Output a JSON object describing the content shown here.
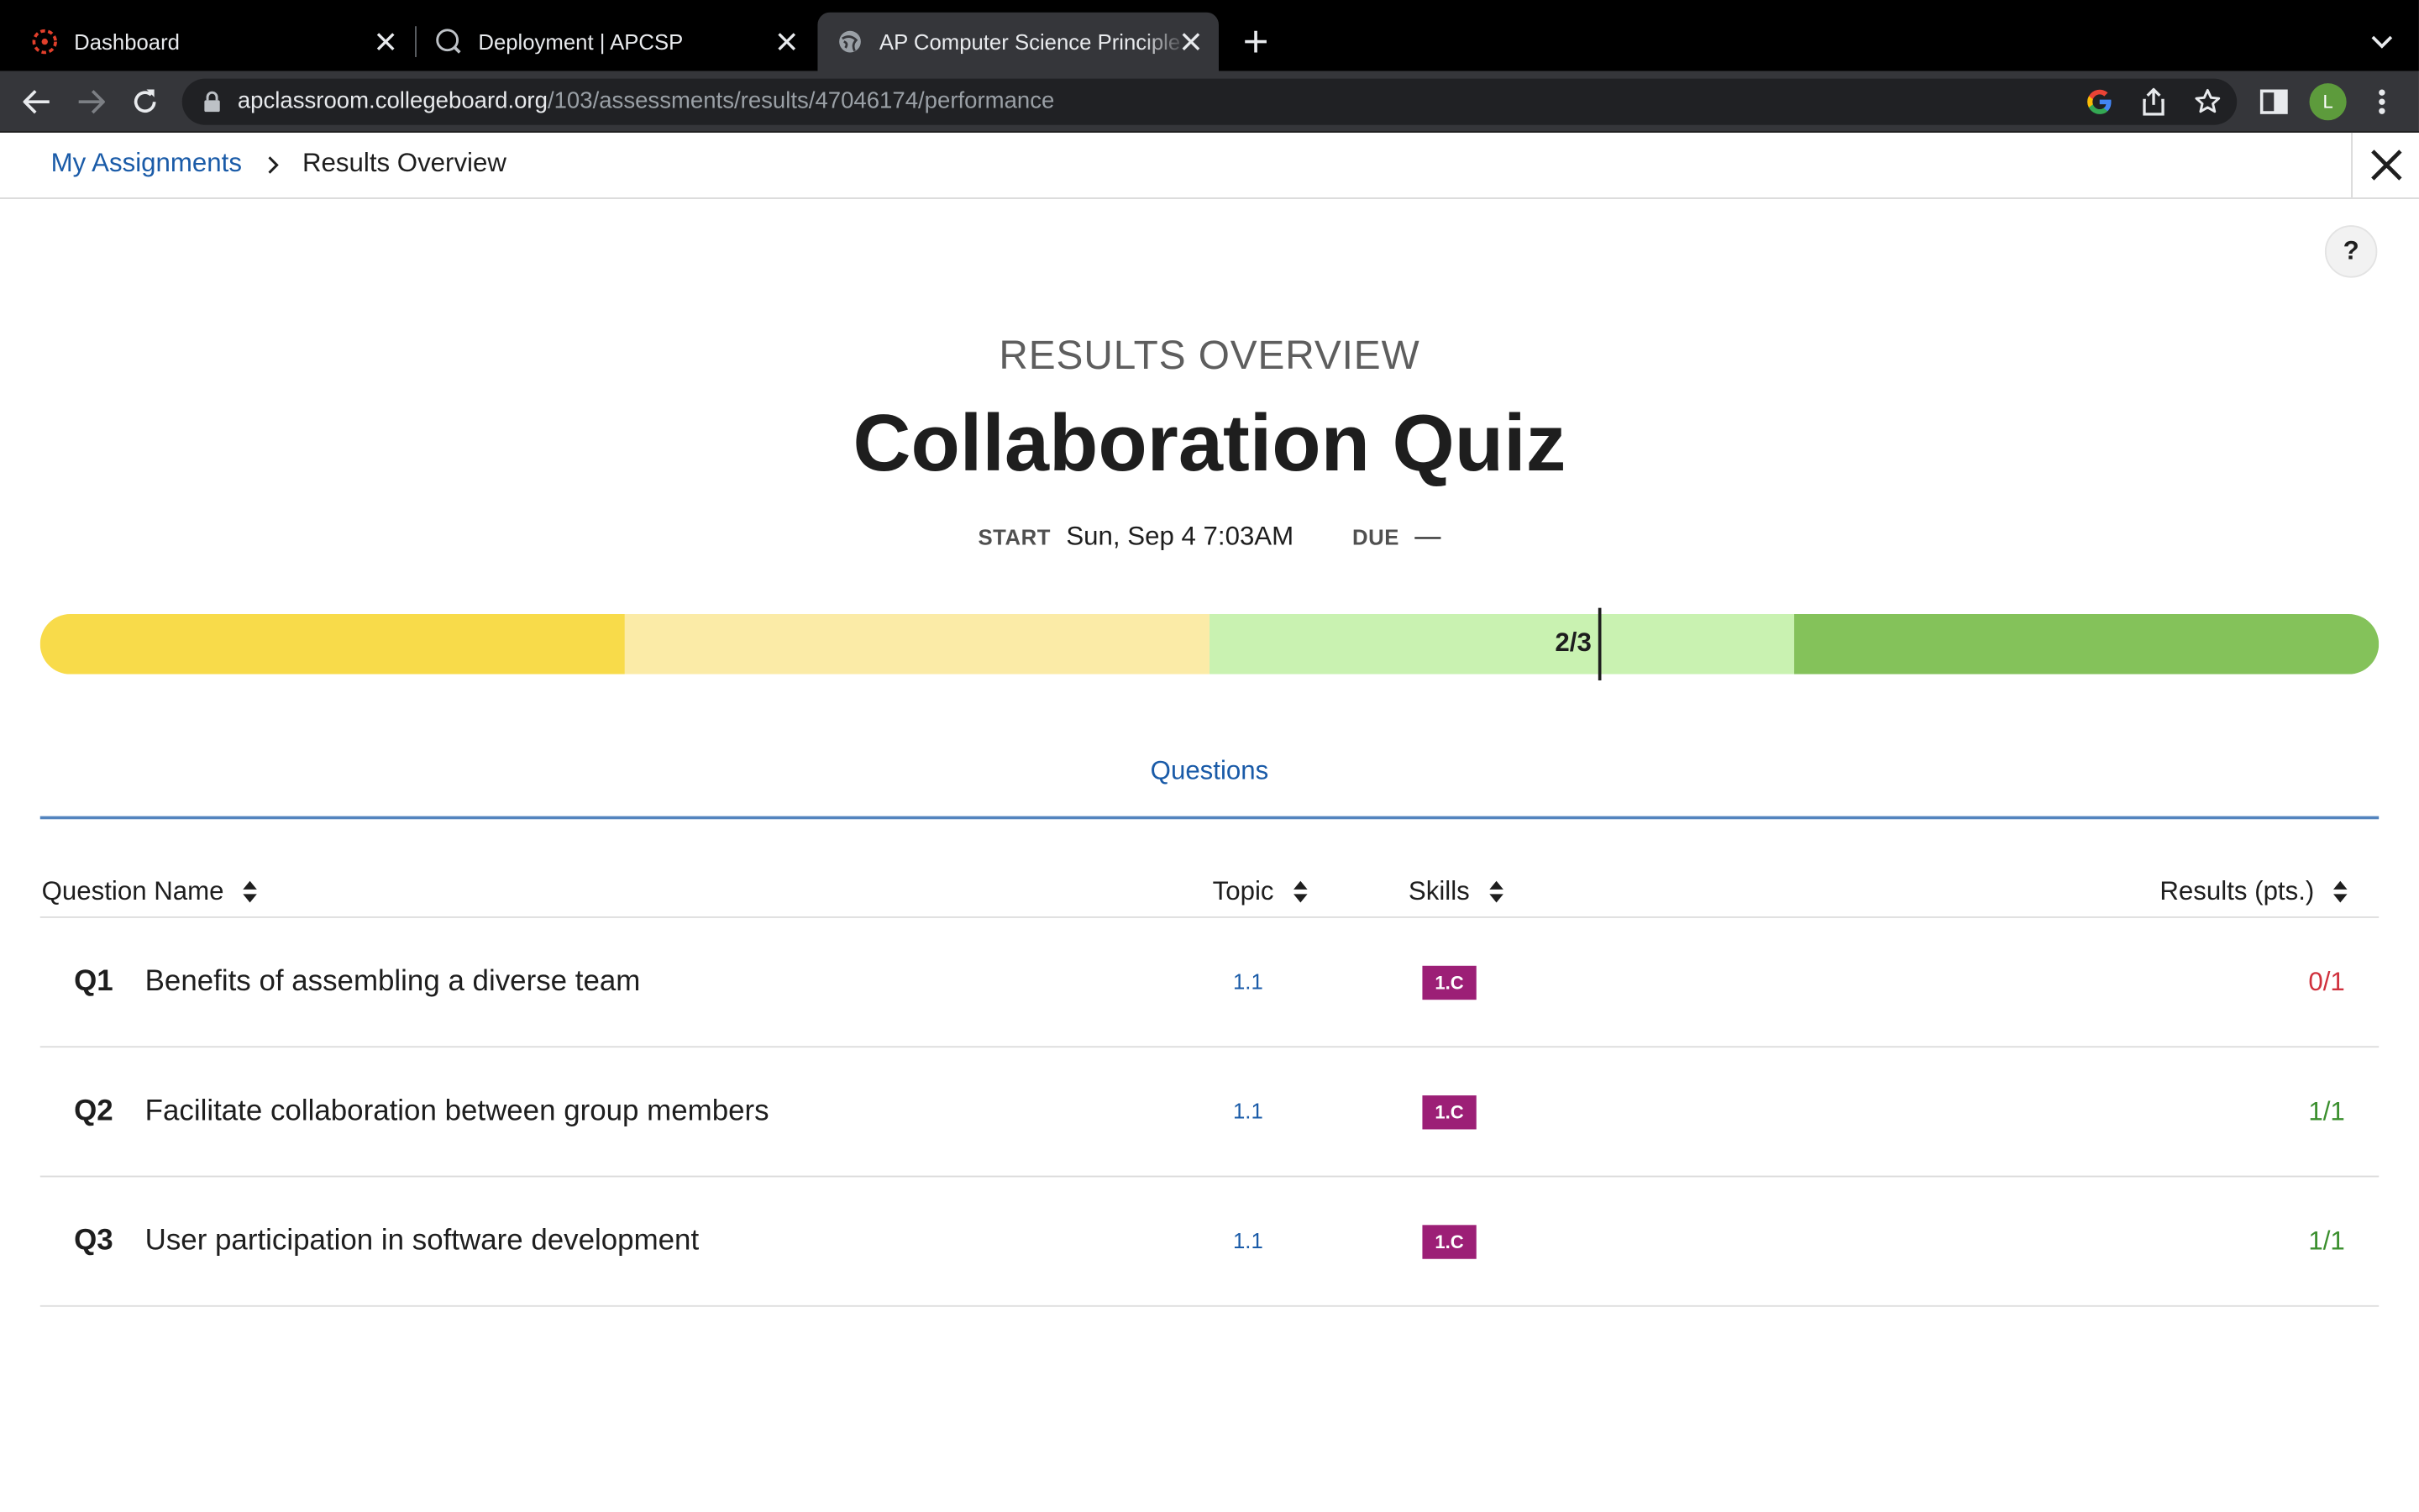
{
  "browser": {
    "tabs": [
      {
        "title": "Dashboard",
        "favicon": "canvas-logo-icon"
      },
      {
        "title": "Deployment | APCSP",
        "favicon": "globe-search-icon"
      },
      {
        "title": "AP Computer Science Principle",
        "favicon": "globe-icon",
        "active": true
      }
    ],
    "url": {
      "host": "apclassroom.collegeboard.org",
      "path": "/103/assessments/results/47046174/performance"
    },
    "profile_initial": "L"
  },
  "breadcrumb": {
    "parent": "My Assignments",
    "current": "Results Overview"
  },
  "help_label": "?",
  "header": {
    "kicker": "RESULTS OVERVIEW",
    "title": "Collaboration Quiz",
    "start_label": "START",
    "start_value": "Sun, Sep 4 7:03AM",
    "due_label": "DUE",
    "due_value": "—"
  },
  "score": {
    "label": "2/3",
    "earned": 2,
    "possible": 3,
    "segment_colors": [
      "#f8db4a",
      "#fbeba7",
      "#c9f2b1",
      "#84c25a"
    ]
  },
  "tabs": {
    "questions_label": "Questions"
  },
  "table": {
    "columns": {
      "name": "Question Name",
      "topic": "Topic",
      "skills": "Skills",
      "results": "Results (pts.)"
    },
    "rows": [
      {
        "num": "Q1",
        "name": "Benefits of assembling a diverse team",
        "topic": "1.1",
        "skill": "1.C",
        "result": "0/1",
        "result_color": "#d0313d"
      },
      {
        "num": "Q2",
        "name": "Facilitate collaboration between group members",
        "topic": "1.1",
        "skill": "1.C",
        "result": "1/1",
        "result_color": "#3b8f2e"
      },
      {
        "num": "Q3",
        "name": "User participation in software development",
        "topic": "1.1",
        "skill": "1.C",
        "result": "1/1",
        "result_color": "#3b8f2e"
      }
    ]
  }
}
